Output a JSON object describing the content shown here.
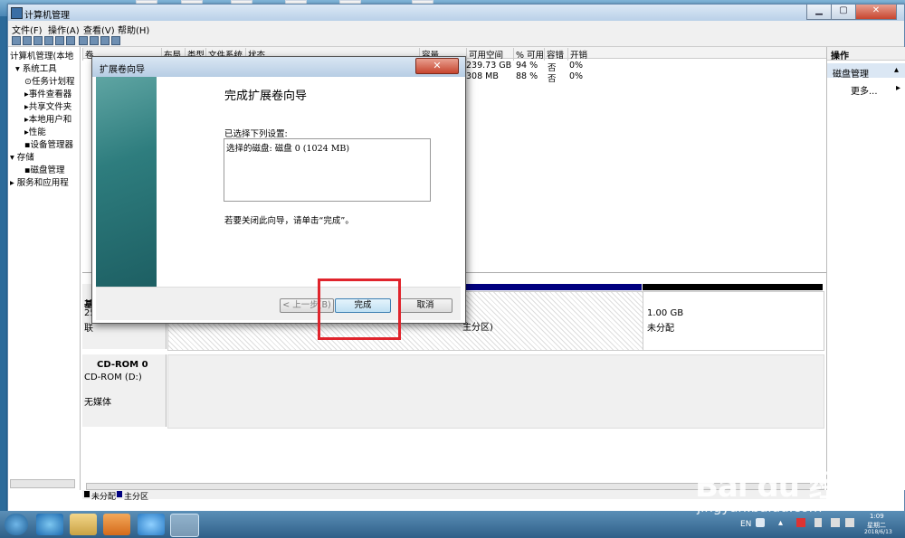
{
  "window": {
    "title": "计算机管理",
    "menu": [
      "文件(F)",
      "操作(A)",
      "查看(V)",
      "帮助(H)"
    ]
  },
  "tree": {
    "root": "计算机管理(本地",
    "items": [
      {
        "label": "系统工具",
        "level": 1
      },
      {
        "label": "任务计划程",
        "level": 2
      },
      {
        "label": "事件查看器",
        "level": 2
      },
      {
        "label": "共享文件夹",
        "level": 2
      },
      {
        "label": "本地用户和",
        "level": 2
      },
      {
        "label": "性能",
        "level": 2
      },
      {
        "label": "设备管理器",
        "level": 2
      },
      {
        "label": "存储",
        "level": 1
      },
      {
        "label": "磁盘管理",
        "level": 2
      },
      {
        "label": "服务和应用程",
        "level": 1
      }
    ]
  },
  "volumes": {
    "columns": [
      "卷",
      "布局",
      "类型",
      "文件系统",
      "状态",
      "容量",
      "可用空间",
      "% 可用",
      "容错",
      "开销"
    ],
    "rows": [
      {
        "free": "239.73 GB",
        "pct": "94 %",
        "fault": "否",
        "overhead": "0%"
      },
      {
        "free": "308 MB",
        "pct": "88 %",
        "fault": "否",
        "overhead": "0%"
      }
    ]
  },
  "disk_area": {
    "disk0_partial": [
      "基",
      "25",
      "联"
    ],
    "partition_tail": "主分区)",
    "unallocated": {
      "size": "1.00 GB",
      "label": "未分配"
    },
    "cdrom": {
      "title": "CD-ROM 0",
      "drive": "CD-ROM (D:)",
      "media": "无媒体"
    },
    "legend": [
      "未分配",
      "主分区"
    ]
  },
  "actions": {
    "header": "操作",
    "section": "磁盘管理",
    "more": "更多..."
  },
  "wizard": {
    "title": "扩展卷向导",
    "close": "✕",
    "heading": "完成扩展卷向导",
    "selected_label": "已选择下列设置:",
    "selected_text": "选择的磁盘: 磁盘 0 (1024 MB)",
    "note": "若要关闭此向导，请单击“完成”。",
    "back": "< 上一步(B)",
    "finish": "完成",
    "cancel": "取消"
  },
  "taskbar": {
    "lang": "EN",
    "time": "1:09",
    "day": "星期二",
    "date": "2018/6/13"
  },
  "watermark": {
    "brand": "Bai du 经验",
    "url": "jingyan.baidu.com"
  },
  "colors": {
    "highlight": "#e0242c",
    "volume_bar": "#00007f"
  }
}
